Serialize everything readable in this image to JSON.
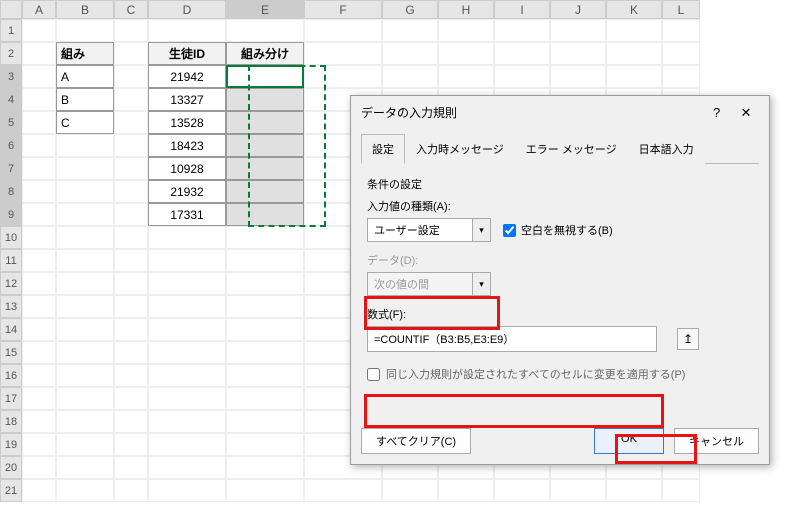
{
  "columns": [
    "A",
    "B",
    "C",
    "D",
    "E",
    "F",
    "G",
    "H",
    "I",
    "J",
    "K",
    "L"
  ],
  "rowCount": 21,
  "selectedCol": "E",
  "selectedRows": [
    3,
    4,
    5,
    6,
    7,
    8,
    9
  ],
  "table1": {
    "header": "組み",
    "rows": [
      "A",
      "B",
      "C"
    ]
  },
  "table2": {
    "headerD": "生徒ID",
    "headerE": "組み分け",
    "ids": [
      "21942",
      "13327",
      "13528",
      "18423",
      "10928",
      "21932",
      "17331"
    ]
  },
  "dialog": {
    "title": "データの入力規則",
    "help": "?",
    "close": "✕",
    "tabs": [
      "設定",
      "入力時メッセージ",
      "エラー メッセージ",
      "日本語入力"
    ],
    "activeTab": 0,
    "sectionHeading": "条件の設定",
    "allowLabel": "入力値の種類(A):",
    "allowValue": "ユーザー設定",
    "ignoreBlankLabel": "空白を無視する(B)",
    "ignoreBlankChecked": true,
    "dataLabel": "データ(D):",
    "dataValue": "次の値の間",
    "formulaLabel": "数式(F):",
    "formulaValue": "=COUNTIF（B3:B5,E3:E9）",
    "applyAllLabel": "同じ入力規則が設定されたすべてのセルに変更を適用する(P)",
    "applyAllChecked": false,
    "clearAll": "すべてクリア(C)",
    "ok": "OK",
    "cancel": "キャンセル",
    "refIcon": "↥"
  }
}
